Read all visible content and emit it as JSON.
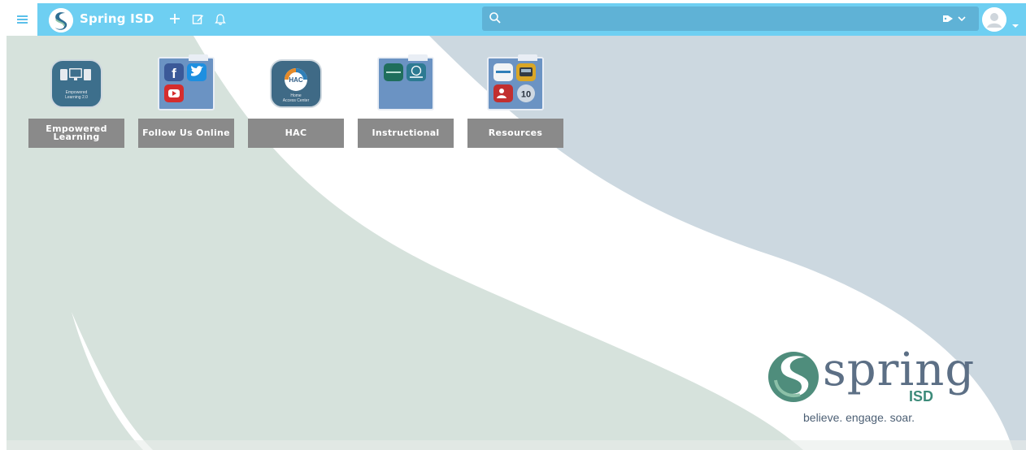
{
  "header": {
    "title": "Spring ISD",
    "icons": [
      "menu-icon",
      "add-icon",
      "edit-icon",
      "bell-icon"
    ],
    "accent_color": "#6ecff2"
  },
  "search": {
    "placeholder": ""
  },
  "apps": [
    {
      "label": "Empowered Learning",
      "icon_text_1": "Empowered",
      "icon_text_2": "Learning 2.0",
      "type": "app"
    },
    {
      "label": "Follow Us Online",
      "type": "folder"
    },
    {
      "label": "HAC",
      "icon_text_1": "HAC",
      "icon_text_2": "Home",
      "icon_text_3": "Access Center",
      "type": "app"
    },
    {
      "label": "Instructional",
      "type": "folder"
    },
    {
      "label": "Resources",
      "type": "folder",
      "badge": "10"
    }
  ],
  "logo": {
    "word": "spring",
    "sub": "ISD",
    "tagline": "believe. engage. soar."
  }
}
